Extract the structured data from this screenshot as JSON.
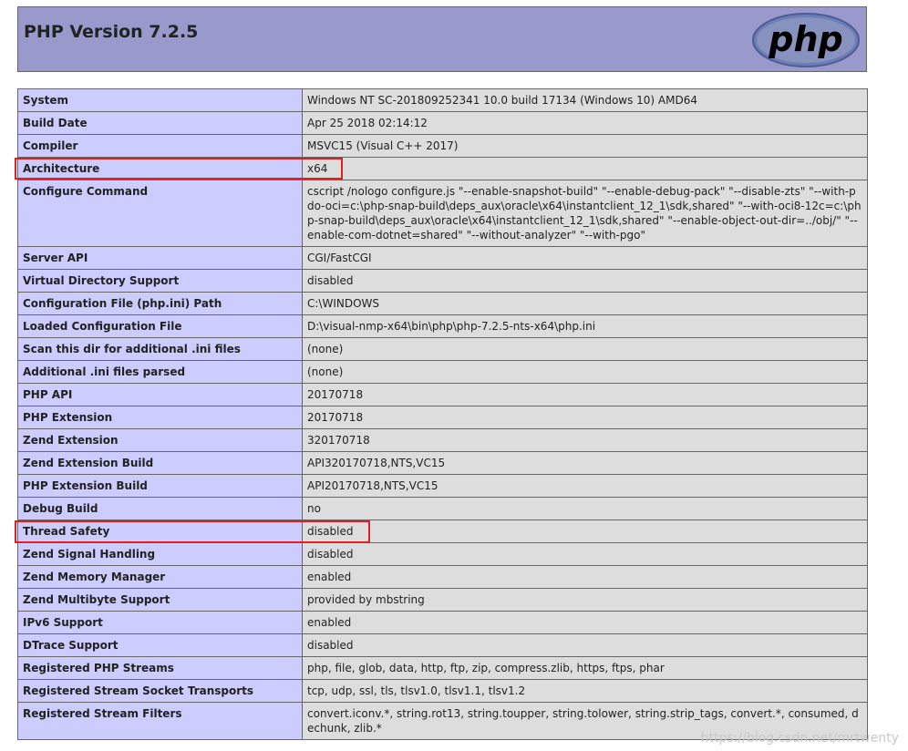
{
  "header": {
    "title": "PHP Version 7.2.5",
    "logo_text": "php",
    "logo_icon": "php-logo-icon"
  },
  "colors": {
    "header_bg": "#9999cc",
    "label_bg": "#ccccff",
    "value_bg": "#dddddd",
    "highlight": "#e02020"
  },
  "rows": [
    {
      "label": "System",
      "value": "Windows NT SC-201809252341 10.0 build 17134 (Windows 10) AMD64"
    },
    {
      "label": "Build Date",
      "value": "Apr 25 2018 02:14:12"
    },
    {
      "label": "Compiler",
      "value": "MSVC15 (Visual C++ 2017)"
    },
    {
      "label": "Architecture",
      "value": "x64"
    },
    {
      "label": "Configure Command",
      "value": "cscript /nologo configure.js \"--enable-snapshot-build\" \"--enable-debug-pack\" \"--disable-zts\" \"--with-pdo-oci=c:\\php-snap-build\\deps_aux\\oracle\\x64\\instantclient_12_1\\sdk,shared\" \"--with-oci8-12c=c:\\php-snap-build\\deps_aux\\oracle\\x64\\instantclient_12_1\\sdk,shared\" \"--enable-object-out-dir=../obj/\" \"--enable-com-dotnet=shared\" \"--without-analyzer\" \"--with-pgo\""
    },
    {
      "label": "Server API",
      "value": "CGI/FastCGI"
    },
    {
      "label": "Virtual Directory Support",
      "value": "disabled"
    },
    {
      "label": "Configuration File (php.ini) Path",
      "value": "C:\\WINDOWS"
    },
    {
      "label": "Loaded Configuration File",
      "value": "D:\\visual-nmp-x64\\bin\\php\\php-7.2.5-nts-x64\\php.ini"
    },
    {
      "label": "Scan this dir for additional .ini files",
      "value": "(none)"
    },
    {
      "label": "Additional .ini files parsed",
      "value": "(none)"
    },
    {
      "label": "PHP API",
      "value": "20170718"
    },
    {
      "label": "PHP Extension",
      "value": "20170718"
    },
    {
      "label": "Zend Extension",
      "value": "320170718"
    },
    {
      "label": "Zend Extension Build",
      "value": "API320170718,NTS,VC15"
    },
    {
      "label": "PHP Extension Build",
      "value": "API20170718,NTS,VC15"
    },
    {
      "label": "Debug Build",
      "value": "no"
    },
    {
      "label": "Thread Safety",
      "value": "disabled"
    },
    {
      "label": "Zend Signal Handling",
      "value": "disabled"
    },
    {
      "label": "Zend Memory Manager",
      "value": "enabled"
    },
    {
      "label": "Zend Multibyte Support",
      "value": "provided by mbstring"
    },
    {
      "label": "IPv6 Support",
      "value": "enabled"
    },
    {
      "label": "DTrace Support",
      "value": "disabled"
    },
    {
      "label": "Registered PHP Streams",
      "value": "php, file, glob, data, http, ftp, zip, compress.zlib, https, ftps, phar"
    },
    {
      "label": "Registered Stream Socket Transports",
      "value": "tcp, udp, ssl, tls, tlsv1.0, tlsv1.1, tlsv1.2"
    },
    {
      "label": "Registered Stream Filters",
      "value": "convert.iconv.*, string.rot13, string.toupper, string.tolower, string.strip_tags, convert.*, consumed, dechunk, zlib.*"
    }
  ],
  "watermark": "https://blog.csdn.net/mrtwenty"
}
